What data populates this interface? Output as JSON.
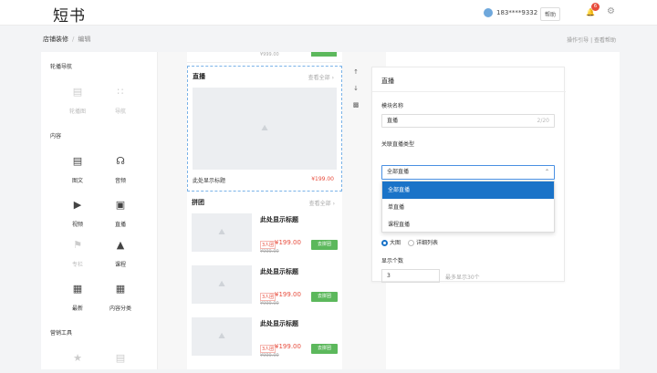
{
  "header": {
    "logo": "短书",
    "phone": "183****9332",
    "help_label": "帮助",
    "notif_count": "6"
  },
  "breadcrumb": {
    "root": "店铺装修",
    "current": "编辑",
    "right": "操作引导 | 查看帮助"
  },
  "left_panel": {
    "groups": [
      {
        "title": "轮播导航",
        "items": [
          {
            "label": "轮播图",
            "icon": "image-icon"
          },
          {
            "label": "导航",
            "icon": "grid-dots-icon"
          }
        ]
      },
      {
        "title": "内容",
        "items": [
          {
            "label": "图文",
            "icon": "image-icon"
          },
          {
            "label": "音频",
            "icon": "headphones-icon"
          },
          {
            "label": "视频",
            "icon": "video-icon"
          },
          {
            "label": "直播",
            "icon": "live-icon"
          },
          {
            "label": "专栏",
            "icon": "bookmark-icon"
          },
          {
            "label": "课程",
            "icon": "graduation-cap-icon"
          },
          {
            "label": "最新",
            "icon": "grid-icon"
          },
          {
            "label": "内容分类",
            "icon": "category-icon"
          }
        ]
      },
      {
        "title": "营销工具",
        "items": []
      }
    ]
  },
  "preview": {
    "live_section": {
      "title": "直播",
      "more": "查看全部",
      "item_title": "此处显示标题",
      "price": "¥199.00"
    },
    "group_section": {
      "title": "拼团",
      "more": "查看全部",
      "items": [
        {
          "name": "此处显示标题",
          "group_tag": "3人团",
          "price": "¥199.00",
          "old_price": "¥999.00",
          "button": "去拼团"
        },
        {
          "name": "此处显示标题",
          "group_tag": "3人团",
          "price": "¥199.00",
          "old_price": "¥999.00",
          "button": "去拼团"
        },
        {
          "name": "此处显示标题",
          "group_tag": "3人团",
          "price": "¥199.00",
          "old_price": "¥999.00",
          "button": "去拼团"
        }
      ]
    }
  },
  "settings": {
    "title": "直播",
    "module_name_label": "模块名称",
    "module_name_value": "直播",
    "module_name_count": "2/20",
    "link_type_label": "关联直播类型",
    "selected": "全部直播",
    "options": [
      "全部直播",
      "单直播",
      "课程直播"
    ],
    "style_options": [
      "大图",
      "详细列表"
    ],
    "count_label": "显示个数",
    "count_value": "3",
    "count_hint": "最多显示30个"
  }
}
